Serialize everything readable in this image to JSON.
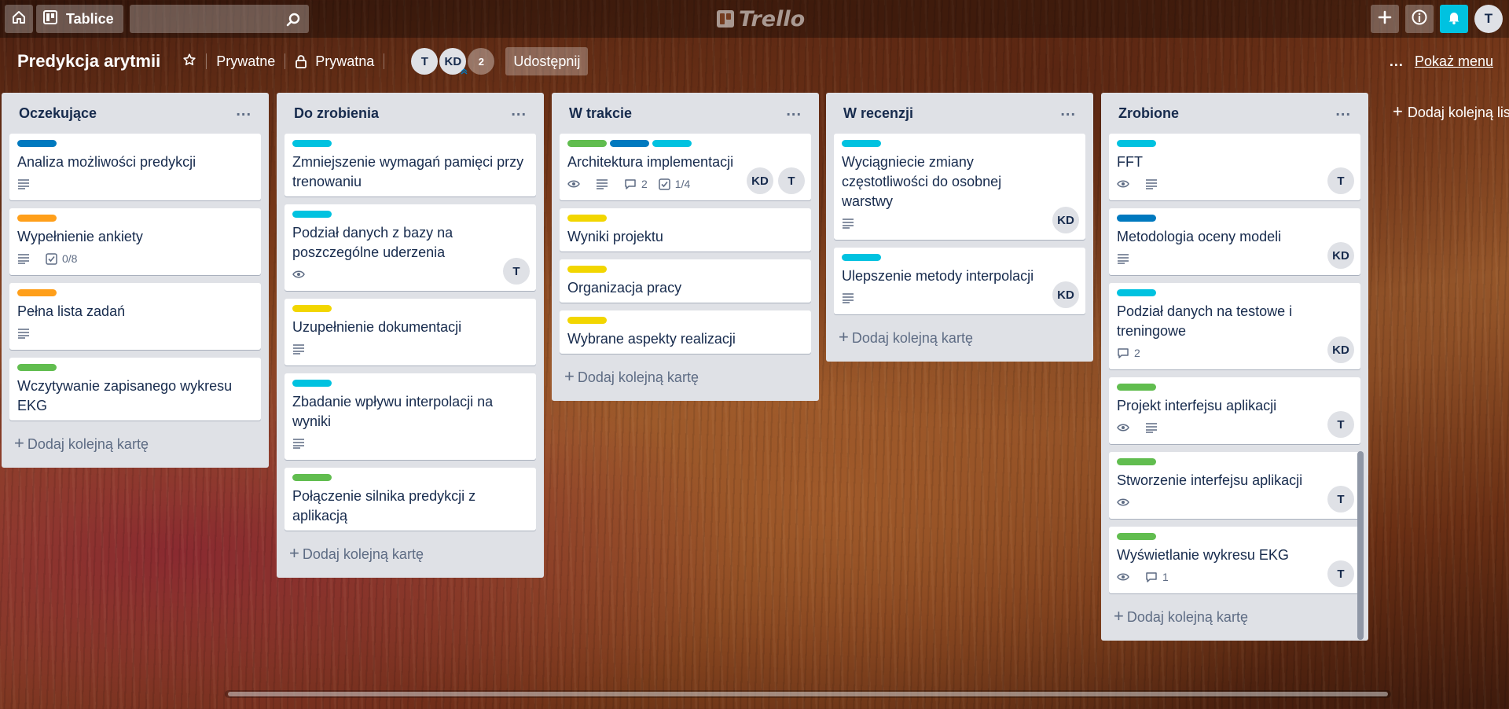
{
  "header": {
    "boards_label": "Tablice",
    "logo_text": "Trello",
    "user_initial": "T",
    "icons": [
      "home-icon",
      "boards-icon",
      "search-icon",
      "plus-icon",
      "info-icon",
      "bell-icon"
    ]
  },
  "board": {
    "title": "Predykcja arytmii",
    "visibility_team": "Prywatne",
    "visibility": "Prywatna",
    "members": [
      "T",
      "KD"
    ],
    "members_more": "2",
    "share_label": "Udostępnij",
    "menu_dots": "...",
    "show_menu_label": "Pokaż menu",
    "add_list_label": "Dodaj kolejną listę"
  },
  "colors": {
    "green": "#61bd4f",
    "yellow": "#f2d600",
    "orange": "#ff9f1a",
    "blue": "#0079bf",
    "sky": "#00c2e0",
    "notification": "#00c2e0"
  },
  "lists": [
    {
      "title": "Oczekujące",
      "menu": "...",
      "add_card": "Dodaj kolejną kartę",
      "cards": [
        {
          "labels": [
            "blue"
          ],
          "title": "Analiza możliwości predykcji",
          "badges": {
            "description": true
          },
          "members": []
        },
        {
          "labels": [
            "orange"
          ],
          "title": "Wypełnienie ankiety",
          "badges": {
            "description": true,
            "checklist": "0/8"
          },
          "members": []
        },
        {
          "labels": [
            "orange"
          ],
          "title": "Pełna lista zadań",
          "badges": {
            "description": true
          },
          "members": []
        },
        {
          "labels": [
            "green"
          ],
          "title": "Wczytywanie zapisanego wykresu EKG",
          "badges": {},
          "members": []
        }
      ]
    },
    {
      "title": "Do zrobienia",
      "menu": "...",
      "add_card": "Dodaj kolejną kartę",
      "cards": [
        {
          "labels": [
            "sky"
          ],
          "title": "Zmniejszenie wymagań pamięci przy trenowaniu",
          "badges": {},
          "members": []
        },
        {
          "labels": [
            "sky"
          ],
          "title": "Podział danych z bazy na poszczególne uderzenia",
          "badges": {
            "watch": true
          },
          "members": [
            "T"
          ]
        },
        {
          "labels": [
            "yellow"
          ],
          "title": "Uzupełnienie dokumentacji",
          "badges": {
            "description": true
          },
          "members": []
        },
        {
          "labels": [
            "sky"
          ],
          "title": "Zbadanie wpływu interpolacji na wyniki",
          "badges": {
            "description": true
          },
          "members": []
        },
        {
          "labels": [
            "green"
          ],
          "title": "Połączenie silnika predykcji z aplikacją",
          "badges": {},
          "members": []
        }
      ]
    },
    {
      "title": "W trakcie",
      "menu": "...",
      "add_card": "Dodaj kolejną kartę",
      "cards": [
        {
          "labels": [
            "green",
            "blue",
            "sky"
          ],
          "title": "Architektura implementacji",
          "badges": {
            "watch": true,
            "description": true,
            "comments": "2",
            "checklist": "1/4"
          },
          "members": [
            "KD",
            "T"
          ]
        },
        {
          "labels": [
            "yellow"
          ],
          "title": "Wyniki projektu",
          "badges": {},
          "members": []
        },
        {
          "labels": [
            "yellow"
          ],
          "title": "Organizacja pracy",
          "badges": {},
          "members": []
        },
        {
          "labels": [
            "yellow"
          ],
          "title": "Wybrane aspekty realizacji",
          "badges": {},
          "members": []
        }
      ]
    },
    {
      "title": "W recenzji",
      "menu": "...",
      "add_card": "Dodaj kolejną kartę",
      "cards": [
        {
          "labels": [
            "sky"
          ],
          "title": "Wyciągniecie zmiany częstotliwości do osobnej warstwy",
          "badges": {
            "description": true
          },
          "members": [
            "KD"
          ]
        },
        {
          "labels": [
            "sky"
          ],
          "title": "Ulepszenie metody interpolacji",
          "badges": {
            "description": true
          },
          "members": [
            "KD"
          ]
        }
      ]
    },
    {
      "title": "Zrobione",
      "menu": "...",
      "add_card": "Dodaj kolejną kartę",
      "cards": [
        {
          "labels": [
            "sky"
          ],
          "title": "FFT",
          "badges": {
            "watch": true,
            "description": true
          },
          "members": [
            "T"
          ]
        },
        {
          "labels": [
            "blue"
          ],
          "title": "Metodologia oceny modeli",
          "badges": {
            "description": true
          },
          "members": [
            "KD"
          ]
        },
        {
          "labels": [
            "sky"
          ],
          "title": "Podział danych na testowe i treningowe",
          "badges": {
            "comments": "2"
          },
          "members": [
            "KD"
          ]
        },
        {
          "labels": [
            "green"
          ],
          "title": "Projekt interfejsu aplikacji",
          "badges": {
            "watch": true,
            "description": true
          },
          "members": [
            "T"
          ]
        },
        {
          "labels": [
            "green"
          ],
          "title": "Stworzenie interfejsu aplikacji",
          "badges": {
            "watch": true
          },
          "members": [
            "T"
          ]
        },
        {
          "labels": [
            "green"
          ],
          "title": "Wyświetlanie wykresu EKG",
          "badges": {
            "watch": true,
            "comments": "1"
          },
          "members": [
            "T"
          ]
        }
      ]
    }
  ]
}
